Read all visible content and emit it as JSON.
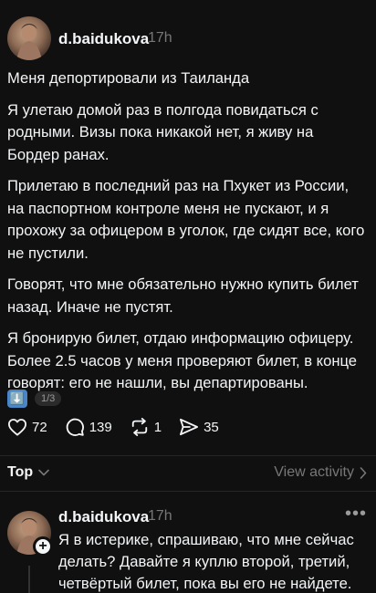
{
  "post": {
    "username": "d.baidukova",
    "time": "17h",
    "title": "Меня депортировали из Таиланда",
    "paragraphs": [
      "Я улетаю домой раз в полгода повидаться с родными. Визы пока никакой нет, я живу на Бордер ранах.",
      "Прилетаю в последний раз на Пхукет из России, на паспортном контроле меня не пускают, и я прохожу за офицером в уголок, где сидят все, кого не пустили.",
      "Говорят, что мне обязательно нужно купить билет назад. Иначе не пустят.",
      "Я бронирую билет, отдаю информацию офицеру. Более 2.5 часов у меня проверяют билет, в конце говорят: его не нашли, вы департированы."
    ],
    "media_emoji": "⬇️",
    "media_counter": "1/3",
    "likes": "72",
    "comments": "139",
    "reposts": "1",
    "shares": "35"
  },
  "sort": {
    "label": "Top",
    "view_activity": "View activity"
  },
  "reply": {
    "username": "d.baidukova",
    "time": "17h",
    "text": "Я в истерике, спрашиваю, что мне сейчас делать? Давайте я куплю второй, третий, четвёртый билет, пока вы его не найдете.",
    "more": "•••"
  },
  "icons": {
    "like": "heart-icon",
    "comment": "comment-icon",
    "repost": "repost-icon",
    "share": "share-icon",
    "chevron": "chevron-down-icon",
    "arrow": "chevron-right-icon"
  }
}
